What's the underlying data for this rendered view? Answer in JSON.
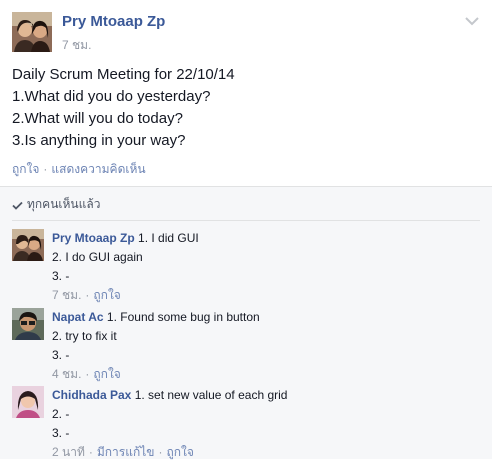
{
  "post": {
    "author": "Pry Mtoaap Zp",
    "time": "7 ชม.",
    "lines": [
      "Daily Scrum Meeting for 22/10/14",
      "1.What did you do yesterday?",
      "2.What will you do today?",
      "3.Is anything in your way?"
    ],
    "like_label": "ถูกใจ",
    "separator": "·",
    "comment_label": "แสดงความคิดเห็น",
    "menu_icon": "chevron-down-icon"
  },
  "seen": {
    "label": "ทุกคนเห็นแล้ว",
    "icon": "checkmark-icon"
  },
  "comments": [
    {
      "name": "Pry Mtoaap Zp",
      "line1": "1. I did GUI",
      "line2": "2. I do GUI again",
      "line3": "3. -",
      "time": "7 ชม.",
      "like_label": "ถูกใจ"
    },
    {
      "name": "Napat Ac",
      "line1": "1. Found some bug in button",
      "line2": "2. try to fix it",
      "line3": "3. -",
      "time": "4 ชม.",
      "like_label": "ถูกใจ"
    },
    {
      "name": "Chidhada Pax",
      "line1": "1. set new value of each grid",
      "line2": "2. -",
      "line3": "3. -",
      "time": "2 นาที",
      "edited_label": "มีการแก้ไข",
      "like_label": "ถูกใจ"
    }
  ],
  "colors": {
    "link": "#3b5998",
    "muted": "#9197a3",
    "action": "#6d84b4",
    "panel": "#f6f7f9"
  }
}
